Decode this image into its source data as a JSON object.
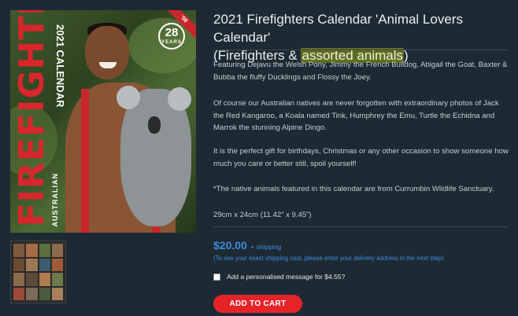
{
  "product": {
    "title_part1": "2021 Firefighters Calendar 'Animal Lovers Calendar'",
    "title_part2_prefix": "(Firefighters & ",
    "title_part2_highlight": "assorted animals",
    "title_part2_suffix": ")",
    "description": [
      "Featuring Dejavu the Welsh Pony, Jimmy the French Bulldog, Abigail the Goat, Baxter & Bubba the fluffy Ducklings and Flossy the Joey.",
      "Of course our Australian natives are never forgotten with extraordinary photos of Jack the Red Kangaroo, a Koala named Tink, Humphrey the Emu, Turtle the Echidna and Marrok the stunning Alpine Dingo.",
      "It is the perfect gift for birthdays, Christmas or any other occasion to show someone how much you care or better still, spoil yourself!",
      "*The native animals featured in this calendar are from Currumbin Wildlife Sanctuary.",
      "29cm x 24cm (11.42” x 9.45”)"
    ],
    "price": "$20.00",
    "shipping_label": "+ shipping",
    "shipping_note": "(To see your exact shipping cost, please enter your delivery address in the next step)",
    "message_option": "Add a personalised message for $4.55?",
    "add_to_cart": "ADD TO CART"
  },
  "cover": {
    "brand": "FIREFIGHTERS",
    "region": "AUSTRALIAN",
    "year_label": "2021 CALENDAR",
    "badge_number": "28",
    "badge_text": "YEARS",
    "ribbon_text": "'08"
  },
  "colors": {
    "background": "#1e2a33",
    "accent_red": "#e5242a",
    "price_blue": "#3d8be0",
    "highlight": "#5f6d22"
  }
}
